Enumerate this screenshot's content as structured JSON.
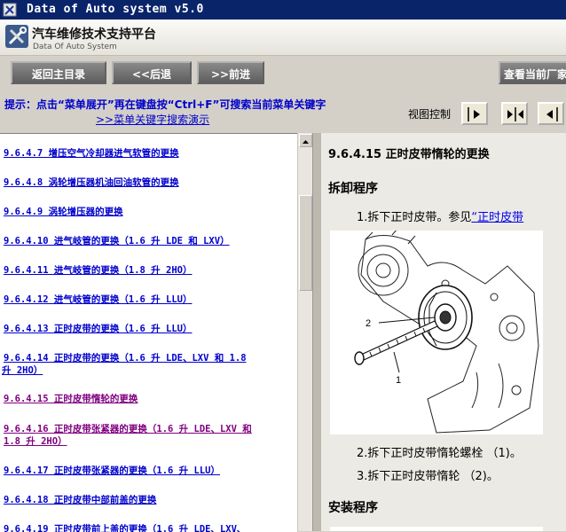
{
  "window": {
    "title": "Data of Auto system v5.0"
  },
  "header": {
    "title_cn": "汽车维修技术支持平台",
    "title_en": "Data Of Auto System"
  },
  "toolbar": {
    "home_label": "返回主目录",
    "back_label": "<<后退",
    "forward_label": ">>前进",
    "vendor_label": "查看当前厂家"
  },
  "hints": {
    "line1": "提示：点击“菜单展开”再在键盘按“Ctrl+F”可搜索当前菜单关键字",
    "line2": ">>菜单关键字搜索演示",
    "view_control": "视图控制"
  },
  "menu": {
    "items": [
      {
        "text": "9.6.4.7 增压空气冷却器进气软管的更换"
      },
      {
        "text": "9.6.4.8 涡轮增压器机油回油软管的更换"
      },
      {
        "text": "9.6.4.9 涡轮增压器的更换"
      },
      {
        "text": "9.6.4.10 进气岐管的更换（1.6 升 LDE 和 LXV）"
      },
      {
        "text": "9.6.4.11 进气岐管的更换（1.8 升 2HO）"
      },
      {
        "text": "9.6.4.12 进气岐管的更换（1.6 升 LLU）"
      },
      {
        "text": "9.6.4.13 正时皮带的更换（1.6 升 LLU）"
      },
      {
        "text": "9.6.4.14 正时皮带的更换（1.6 升 LDE、LXV 和 1.8",
        "text2": "升 2HO）"
      },
      {
        "text": "9.6.4.15 正时皮带惰轮的更换"
      },
      {
        "text": "9.6.4.16 正时皮带张紧器的更换（1.6 升 LDE、LXV 和",
        "text2": "1.8 升 2HO）"
      },
      {
        "text": "9.6.4.17 正时皮带张紧器的更换（1.6 升 LLU）"
      },
      {
        "text": "9.6.4.18 正时皮带中部前盖的更换"
      },
      {
        "text": "9.6.4.19 正时皮带前上盖的更换（1.6 升 LDE、LXV、"
      }
    ]
  },
  "content": {
    "title": "9.6.4.15 正时皮带惰轮的更换",
    "removal_heading": "拆卸程序",
    "step1_prefix": "1.拆下正时皮带。参见",
    "step1_link": "“正时皮带",
    "figure_label_2": "2",
    "figure_label_1": "1",
    "step2": "2.拆下正时皮带惰轮螺栓 （1)。",
    "step3": "3.拆下正时皮带惰轮 （2)。",
    "install_heading": "安装程序"
  }
}
